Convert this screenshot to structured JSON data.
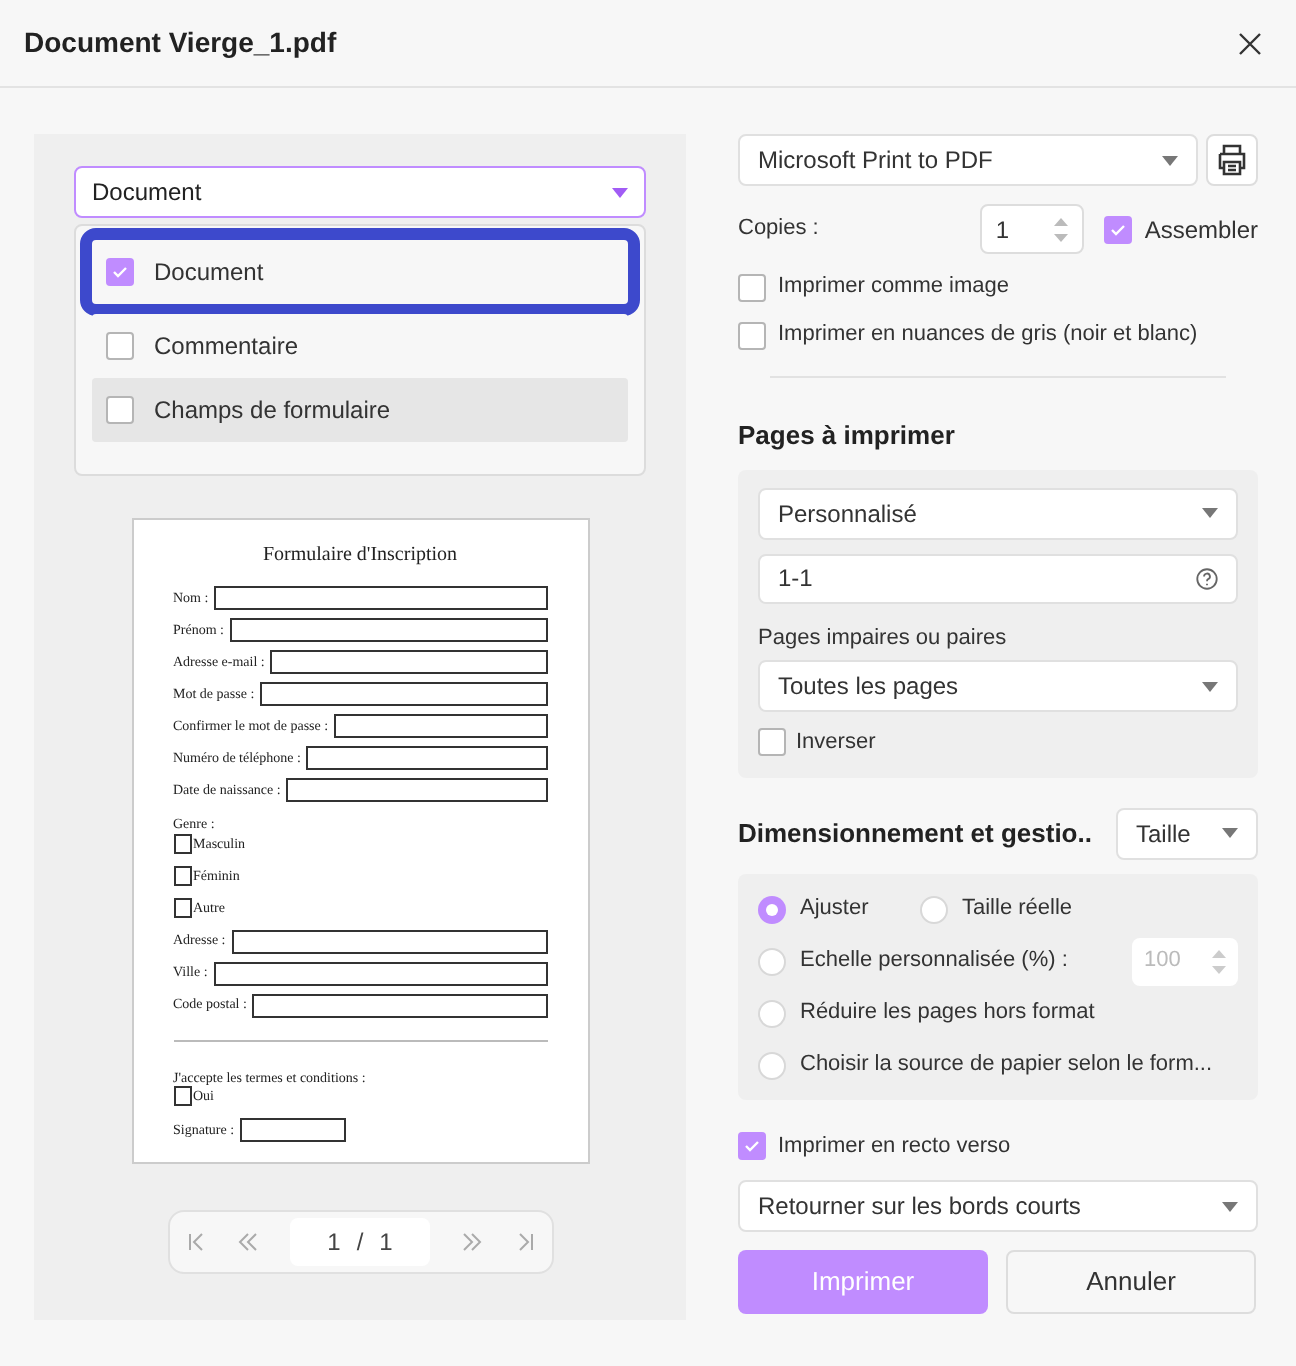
{
  "window": {
    "title": "Document Vierge_1.pdf"
  },
  "content_select": {
    "value": "Document",
    "options": [
      {
        "label": "Document",
        "checked": true,
        "focused": true,
        "hovered": false
      },
      {
        "label": "Commentaire",
        "checked": false,
        "focused": false,
        "hovered": false
      },
      {
        "label": "Champs de formulaire",
        "checked": false,
        "focused": false,
        "hovered": true
      }
    ]
  },
  "preview": {
    "title": "Formulaire d'Inscription",
    "items": [
      {
        "kind": "field",
        "label": "Nom :"
      },
      {
        "kind": "field",
        "label": "Prénom :"
      },
      {
        "kind": "field",
        "label": "Adresse e-mail :"
      },
      {
        "kind": "field",
        "label": "Mot de passe :"
      },
      {
        "kind": "field",
        "label": "Confirmer le mot de passe :"
      },
      {
        "kind": "field",
        "label": "Numéro de téléphone :"
      },
      {
        "kind": "field",
        "label": "Date de naissance :"
      },
      {
        "kind": "heading",
        "label": "Genre :"
      },
      {
        "kind": "checkbox",
        "label": "Masculin",
        "checked": false
      },
      {
        "kind": "checkbox",
        "label": "Féminin",
        "checked": false
      },
      {
        "kind": "checkbox",
        "label": "Autre",
        "checked": false
      },
      {
        "kind": "field",
        "label": "Adresse :"
      },
      {
        "kind": "field",
        "label": "Ville :"
      },
      {
        "kind": "field",
        "label": "Code postal :"
      },
      {
        "kind": "rule"
      },
      {
        "kind": "heading",
        "label": "J'accepte les termes et conditions :"
      },
      {
        "kind": "checkbox",
        "label": "Oui",
        "checked": false
      },
      {
        "kind": "short_field",
        "label": "Signature :"
      }
    ]
  },
  "pager": {
    "current": "1",
    "separator": "/",
    "total": "1"
  },
  "printer": {
    "value": "Microsoft Print to PDF"
  },
  "copies": {
    "label": "Copies :",
    "value": "1"
  },
  "collate": {
    "label": "Assembler",
    "checked": true
  },
  "options": [
    {
      "label": "Imprimer comme image",
      "checked": false
    },
    {
      "label": "Imprimer en nuances de gris (noir et blanc)",
      "checked": false
    }
  ],
  "pages": {
    "heading": "Pages à imprimer",
    "range_select": "Personnalisé",
    "range_value": "1-1",
    "parity_label": "Pages impaires ou paires",
    "parity_select": "Toutes les pages",
    "reverse": {
      "label": "Inverser",
      "checked": false
    }
  },
  "sizing": {
    "heading": "Dimensionnement et gestio..",
    "mode": "Taille",
    "choices": [
      {
        "label": "Ajuster",
        "selected": true
      },
      {
        "label": "Taille réelle",
        "selected": false
      },
      {
        "label": "Echelle personnalisée (%) :",
        "selected": false,
        "placeholder": "100"
      },
      {
        "label": "Réduire les pages hors format",
        "selected": false
      },
      {
        "label": "Choisir la source de papier selon le form...",
        "selected": false
      }
    ]
  },
  "duplex": {
    "label": "Imprimer en recto verso",
    "checked": true,
    "select": "Retourner sur les bords courts"
  },
  "buttons": {
    "print": "Imprimer",
    "cancel": "Annuler"
  }
}
